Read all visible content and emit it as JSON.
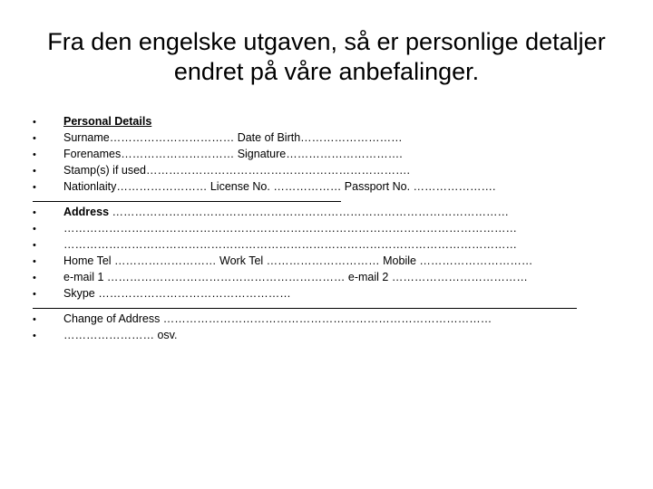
{
  "slide": {
    "title": "Fra den engelske utgaven, så er personlige detaljer endret på våre anbefalinger.",
    "bullet_glyph": "•",
    "groups": [
      {
        "name": "personal-details",
        "rule_above": false,
        "lines": [
          {
            "style": "bold-underline",
            "text": "Personal Details"
          },
          {
            "style": "normal",
            "text": "Surname…………………………… Date of Birth………………………"
          },
          {
            "style": "normal",
            "text": "Forenames………………………… Signature…………………………."
          },
          {
            "style": "normal",
            "text": "Stamp(s) if used……………………………………………………………."
          },
          {
            "style": "normal",
            "text": "Nationlaity…………………… License No. ……………… Passport No. …………………."
          }
        ]
      },
      {
        "name": "address",
        "rule_above": true,
        "rule_width": "narrow",
        "lines": [
          {
            "style": "bold-lead",
            "lead": "Address",
            "text": " ……………………………………………………………………………………………"
          },
          {
            "style": "normal",
            "text": "…………………………………………………………………………………………………………"
          },
          {
            "style": "normal",
            "text": "…………………………………………………………………………………………………………"
          },
          {
            "style": "normal",
            "text": "Home Tel ……………………… Work Tel ………………………… Mobile …………………………"
          },
          {
            "style": "normal",
            "text": "e-mail 1 ……………………………………………………… e-mail 2 ………………………………"
          },
          {
            "style": "normal",
            "text": "Skype ……………………………………………"
          }
        ]
      },
      {
        "name": "change-of-address",
        "rule_above": true,
        "rule_width": "wide",
        "lines": [
          {
            "style": "normal",
            "text": "Change of Address ……………………………………………………………………………"
          },
          {
            "style": "normal",
            "text": "…………………… osv."
          }
        ]
      }
    ]
  }
}
